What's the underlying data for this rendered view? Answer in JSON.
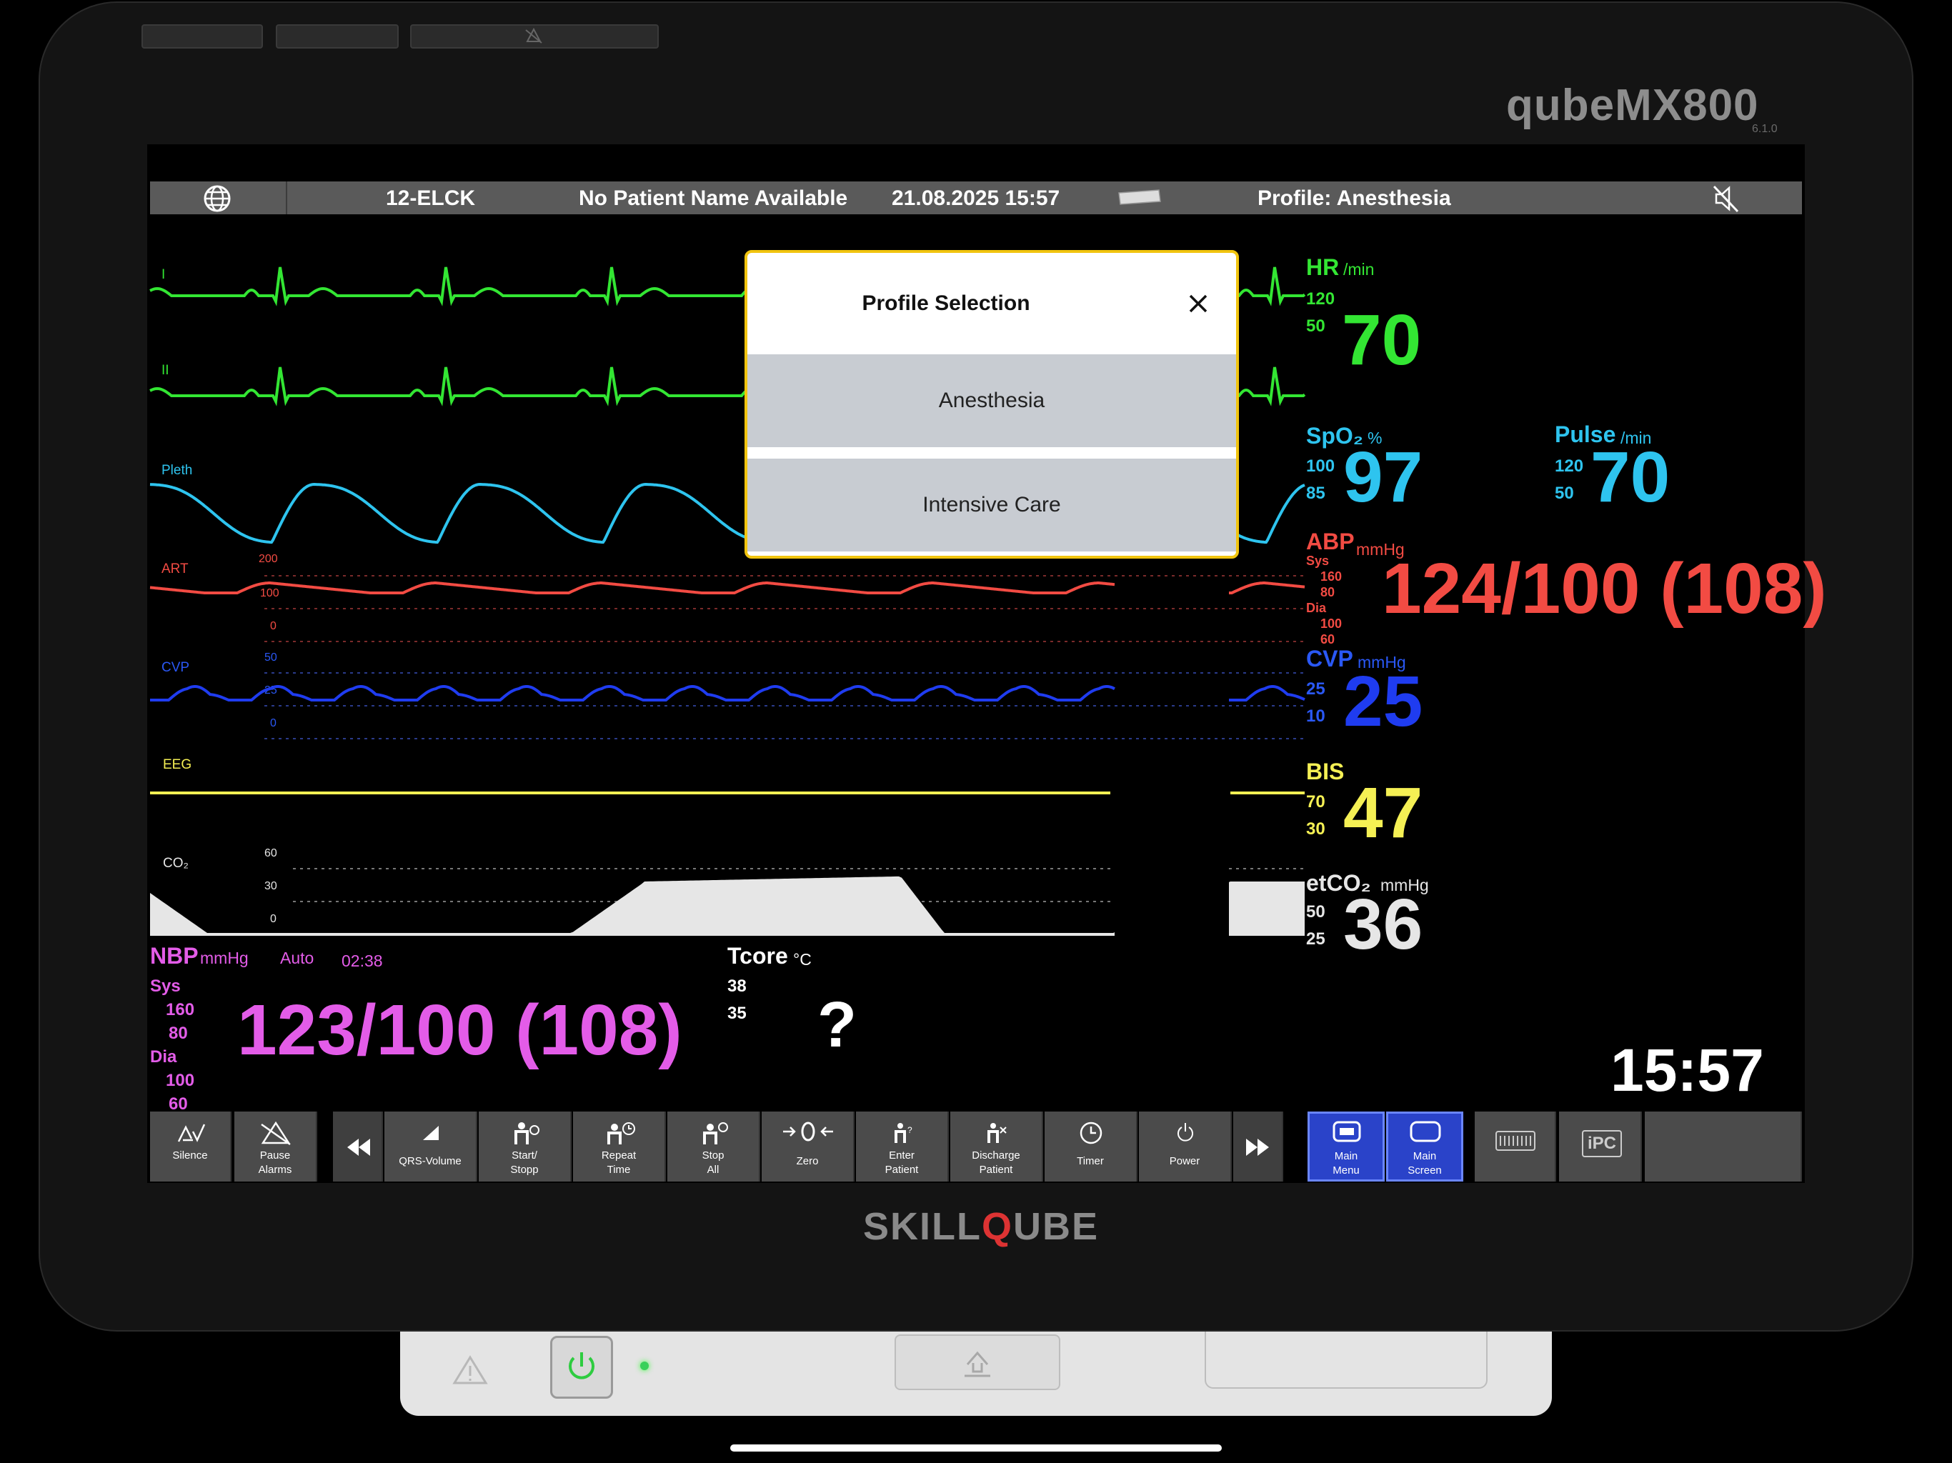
{
  "device": {
    "model": "qubeMX800",
    "version": "6.1.0",
    "logo_pre": "SKILL",
    "logo_q": "Q",
    "logo_post": "UBE"
  },
  "status_bar": {
    "bed": "12-ELCK",
    "patient": "No Patient Name Available",
    "datetime": "21.08.2025 15:57",
    "profile": "Profile: Anesthesia"
  },
  "waves": {
    "ecg1_label": "I",
    "ecg2_label": "II",
    "pleth_label": "Pleth",
    "art_label": "ART",
    "art_scale": [
      "200",
      "100",
      "0"
    ],
    "cvp_label": "CVP",
    "cvp_scale": [
      "50",
      "25",
      "0"
    ],
    "eeg_label": "EEG",
    "co2_label": "CO₂",
    "co2_scale": [
      "60",
      "30",
      "0"
    ]
  },
  "params": {
    "hr": {
      "name": "HR",
      "unit": "/min",
      "hi": "120",
      "lo": "50",
      "value": "70"
    },
    "spo2": {
      "name": "SpO₂",
      "unit": "%",
      "hi": "100",
      "lo": "85",
      "value": "97"
    },
    "pulse": {
      "name": "Pulse",
      "unit": "/min",
      "hi": "120",
      "lo": "50",
      "value": "70"
    },
    "abp": {
      "name": "ABP",
      "unit": "mmHg",
      "sys_label": "Sys",
      "sys_hi": "160",
      "sys_lo": "80",
      "dia_label": "Dia",
      "dia_hi": "100",
      "dia_lo": "60",
      "value": "124/100 (108)"
    },
    "cvp": {
      "name": "CVP",
      "unit": "mmHg",
      "hi": "25",
      "lo": "10",
      "value": "25"
    },
    "bis": {
      "name": "BIS",
      "hi": "70",
      "lo": "30",
      "value": "47"
    },
    "etco2": {
      "name": "etCO₂",
      "unit": "mmHg",
      "hi": "50",
      "lo": "25",
      "value": "36"
    },
    "nbp": {
      "name": "NBP",
      "unit": "mmHg",
      "mode": "Auto",
      "time": "02:38",
      "sys_label": "Sys",
      "sys_hi": "160",
      "sys_lo": "80",
      "dia_label": "Dia",
      "dia_hi": "100",
      "dia_lo": "60",
      "value": "123/100 (108)"
    },
    "tcore": {
      "name": "Tcore",
      "unit": "°C",
      "hi": "38",
      "lo": "35",
      "value": "?"
    }
  },
  "clock": "15:57",
  "dialog": {
    "title": "Profile Selection",
    "options": [
      "Anesthesia",
      "Intensive Care"
    ]
  },
  "toolbar": {
    "silence": "Silence",
    "pause_1": "Pause",
    "pause_2": "Alarms",
    "qrs": "QRS-Volume",
    "start_1": "Start/",
    "start_2": "Stopp",
    "repeat_1": "Repeat",
    "repeat_2": "Time",
    "stop_1": "Stop",
    "stop_2": "All",
    "zero": "Zero",
    "enter_1": "Enter",
    "enter_2": "Patient",
    "discharge_1": "Discharge",
    "discharge_2": "Patient",
    "timer": "Timer",
    "power": "Power",
    "mainmenu_1": "Main",
    "mainmenu_2": "Menu",
    "mainscreen_1": "Main",
    "mainscreen_2": "Screen",
    "ipc": "iPC"
  },
  "colors": {
    "ecg": "#33e633",
    "spo2": "#2ec4ef",
    "abp": "#f24b43",
    "cvp": "#1f3cf0",
    "bis": "#f5f054",
    "etco2": "#e6e6e6",
    "nbp": "#e35ce8",
    "accent": "#f1c40f"
  }
}
